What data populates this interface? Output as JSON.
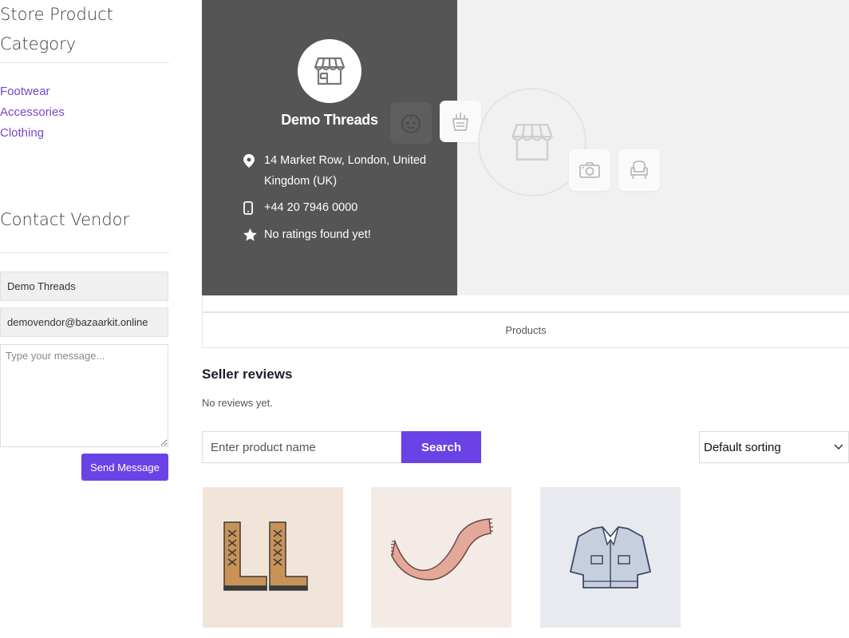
{
  "sidebar": {
    "categories_title": "Store Product Category",
    "categories": [
      "Footwear",
      "Accessories",
      "Clothing"
    ],
    "contact_title": "Contact Vendor",
    "name_value": "Demo Threads",
    "email_value": "demovendor@bazaarkit.online",
    "message_placeholder": "Type your message...",
    "send_label": "Send Message"
  },
  "store": {
    "name": "Demo Threads",
    "address": "14 Market Row, London, United Kingdom (UK)",
    "phone": "+44 20 7946 0000",
    "rating": "No ratings found yet!"
  },
  "tabs": {
    "products": "Products"
  },
  "reviews": {
    "title": "Seller reviews",
    "empty": "No reviews yet."
  },
  "search": {
    "placeholder": "Enter product name",
    "button": "Search"
  },
  "sorting": {
    "selected": "Default sorting"
  },
  "products": [
    {
      "icon": "boots-icon",
      "bg": "#f1e5da"
    },
    {
      "icon": "scarf-icon",
      "bg": "#f4ebe6"
    },
    {
      "icon": "jacket-icon",
      "bg": "#e9eaf0"
    }
  ],
  "colors": {
    "accent": "#6b42e6",
    "link": "#7b45c6",
    "banner_dark": "#555555"
  }
}
